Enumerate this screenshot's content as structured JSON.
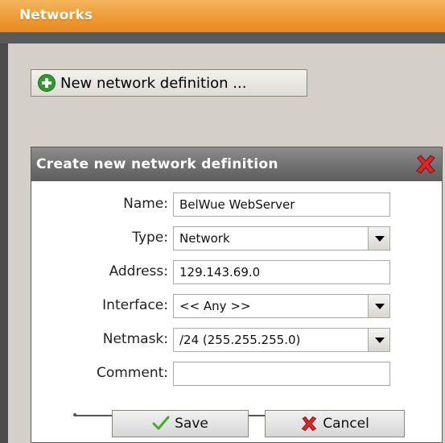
{
  "header": {
    "title": "Networks"
  },
  "toolbar": {
    "new_label": "New network definition ..."
  },
  "dialog": {
    "title": "Create new network definition",
    "fields": [
      {
        "label": "Name:",
        "value": "BelWue WebServer",
        "kind": "text"
      },
      {
        "label": "Type:",
        "value": "Network",
        "kind": "select"
      },
      {
        "label": "Address:",
        "value": "129.143.69.0",
        "kind": "text"
      },
      {
        "label": "Interface:",
        "value": "<< Any >>",
        "kind": "select"
      },
      {
        "label": "Netmask:",
        "value": "/24 (255.255.255.0)",
        "kind": "select"
      },
      {
        "label": "Comment:",
        "value": "",
        "kind": "text"
      }
    ],
    "save_label": "Save",
    "cancel_label": "Cancel"
  },
  "colors": {
    "header": "#ef9a34",
    "close": "#d9262b",
    "plus": "#2e9b2e"
  }
}
